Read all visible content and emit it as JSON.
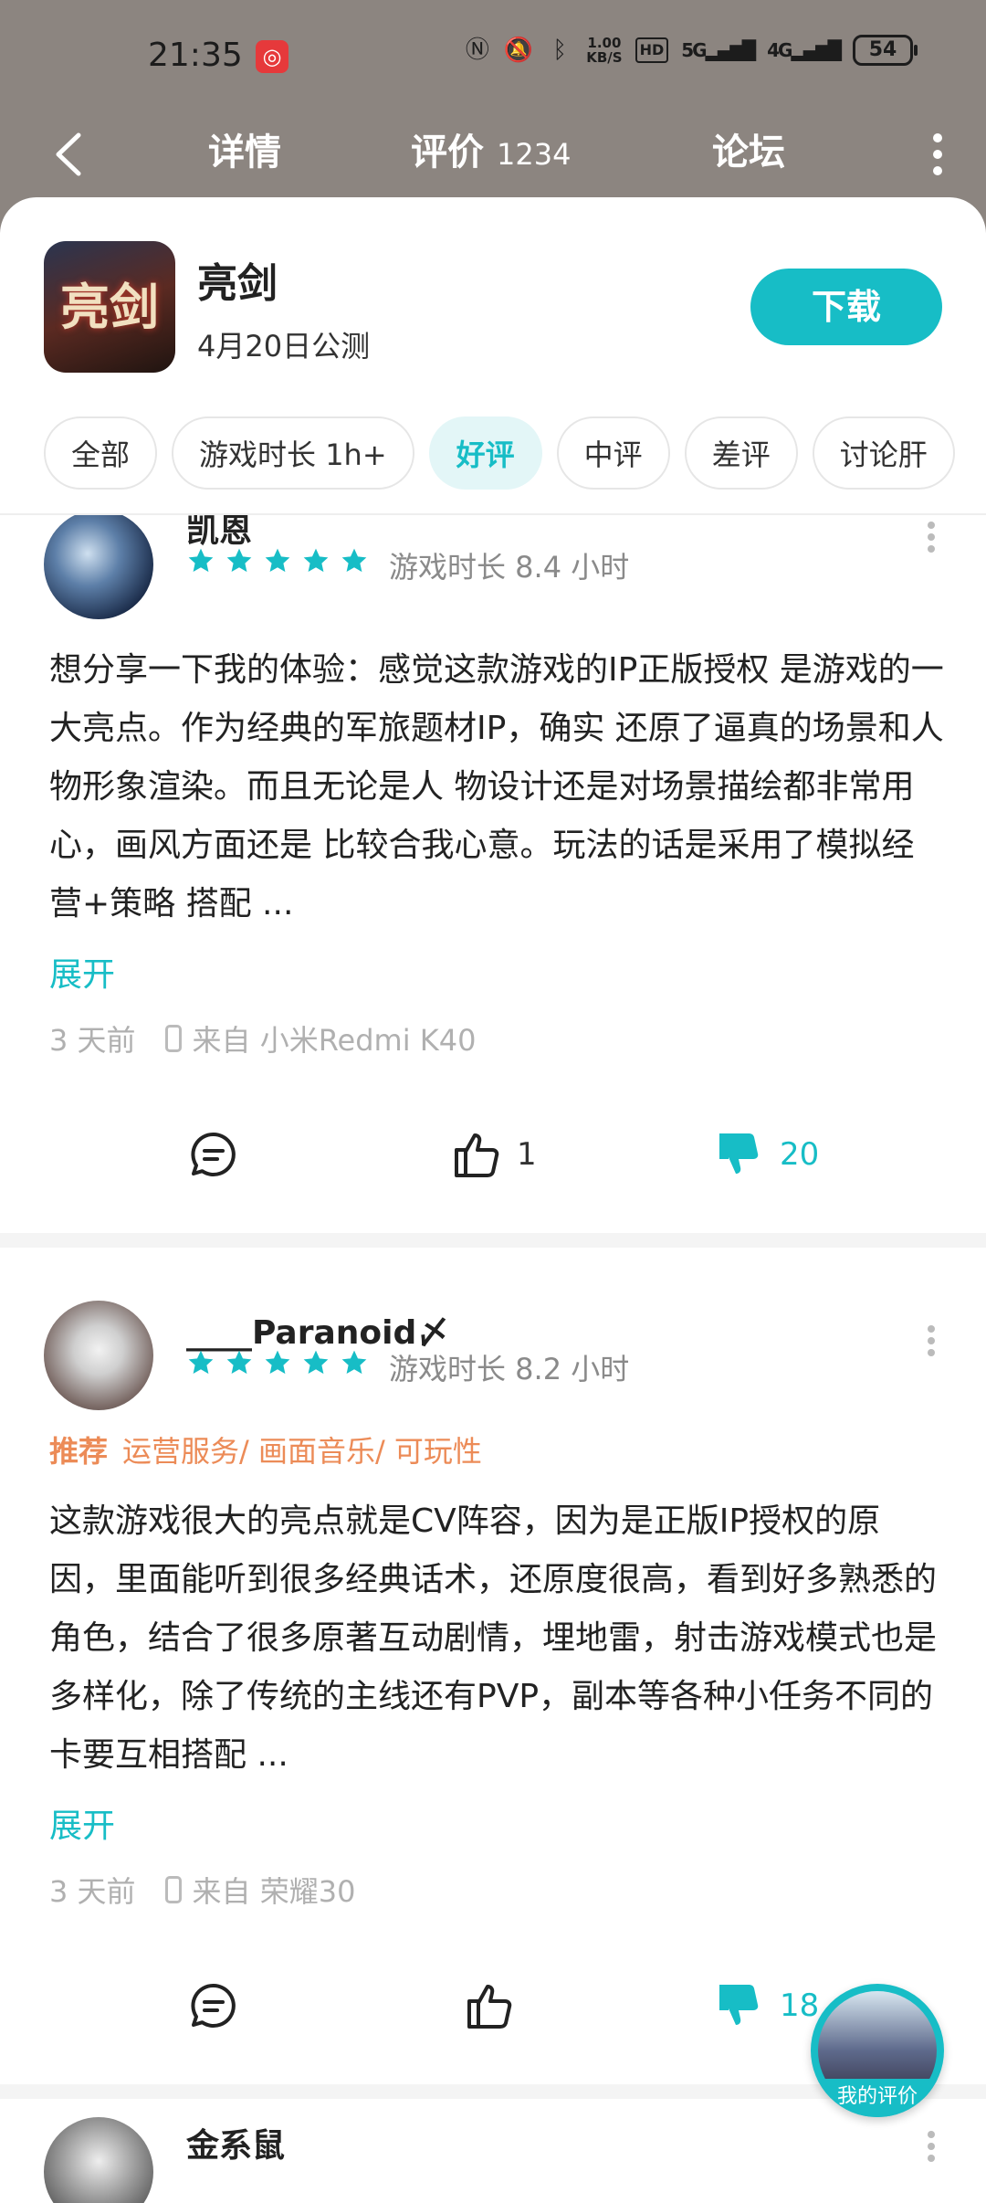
{
  "status_bar": {
    "time": "21:35",
    "speed_top": "1.00",
    "speed_bottom": "KB/S",
    "hd": "HD",
    "sig1": "5G",
    "sig2": "4G",
    "battery": "54"
  },
  "nav": {
    "tab_details": "详情",
    "tab_reviews": "评价",
    "review_count": "1234",
    "tab_forum": "论坛"
  },
  "game": {
    "icon_text": "亮剑",
    "title": "亮剑",
    "subtitle": "4月20日公测",
    "download_label": "下载"
  },
  "filters": [
    "全部",
    "游戏时长 1h+",
    "好评",
    "中评",
    "差评",
    "讨论肝"
  ],
  "reviews": [
    {
      "username": "凯恩",
      "playtime": "游戏时长 8.4 小时",
      "body": "想分享一下我的体验：感觉这款游戏的IP正版授权 是游戏的一大亮点。作为经典的军旅题材IP，确实 还原了逼真的场景和人物形象渲染。而且无论是人 物设计还是对场景描绘都非常用心，画风方面还是 比较合我心意。玩法的话是采用了模拟经营+策略 搭配 ...",
      "expand": "展开",
      "time": "3 天前",
      "device": "来自 小米Redmi K40",
      "likes": "1",
      "dislikes": "20"
    },
    {
      "username": "____Paranoid〆",
      "playtime": "游戏时长 8.2 小时",
      "tag_label": "推荐",
      "tags": "运营服务/ 画面音乐/ 可玩性",
      "body": "这款游戏很大的亮点就是CV阵容，因为是正版IP授权的原因，里面能听到很多经典话术，还原度很高，看到好多熟悉的角色，结合了很多原著互动剧情，埋地雷，射击游戏模式也是多样化，除了传统的主线还有PVP，副本等各种小任务不同的卡要互相搭配 ...",
      "expand": "展开",
      "time": "3 天前",
      "device": "来自 荣耀30",
      "likes": "",
      "dislikes": "18"
    },
    {
      "username": "金系鼠"
    }
  ],
  "fab": {
    "label": "我的评价"
  },
  "colors": {
    "accent": "#17bdc6",
    "tag": "#ec8b57",
    "header_bg": "#8c8580"
  }
}
